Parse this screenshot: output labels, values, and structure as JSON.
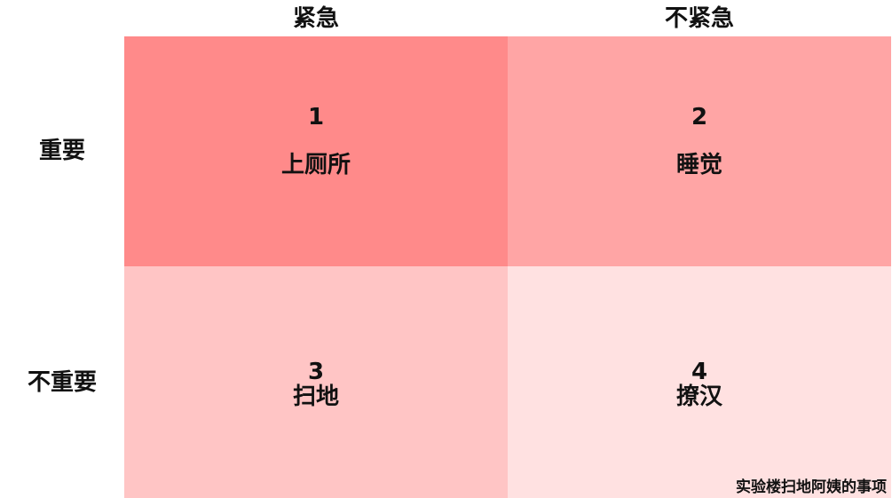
{
  "columns": [
    "紧急",
    "不紧急"
  ],
  "rows": [
    "重要",
    "不重要"
  ],
  "quadrants": [
    {
      "number": "1",
      "label": "上厕所"
    },
    {
      "number": "2",
      "label": "睡觉"
    },
    {
      "number": "3",
      "label": "扫地"
    },
    {
      "number": "4",
      "label": "撩汉"
    }
  ],
  "caption": "实验楼扫地阿姨的事项",
  "colors": {
    "q1": "#ff8a8a",
    "q2": "#ffa5a5",
    "q3": "#ffc5c5",
    "q4": "#ffe1e1"
  }
}
